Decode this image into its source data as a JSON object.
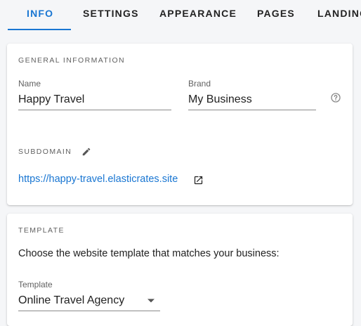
{
  "tabs": [
    {
      "label": "INFO",
      "active": true
    },
    {
      "label": "SETTINGS",
      "active": false
    },
    {
      "label": "APPEARANCE",
      "active": false
    },
    {
      "label": "PAGES",
      "active": false
    },
    {
      "label": "LANDING",
      "active": false
    }
  ],
  "general": {
    "section_title": "GENERAL INFORMATION",
    "name_label": "Name",
    "name_value": "Happy Travel",
    "brand_label": "Brand",
    "brand_value": "My Business",
    "help_icon": "help-circle-outline",
    "subdomain_title": "SUBDOMAIN",
    "edit_icon": "pencil",
    "subdomain_url": "https://happy-travel.elasticrates.site",
    "open_icon": "open-in-new"
  },
  "template": {
    "section_title": "TEMPLATE",
    "description": "Choose the website template that matches your business:",
    "select_label": "Template",
    "select_value": "Online Travel Agency",
    "dropdown_icon": "caret-down"
  },
  "colors": {
    "accent": "#1976d2",
    "background": "#f5f6f8"
  }
}
